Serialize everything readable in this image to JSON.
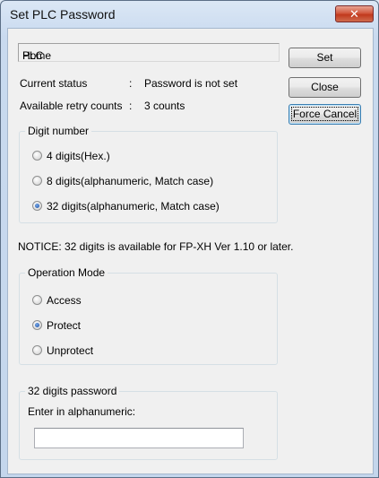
{
  "window": {
    "title": "Set PLC Password",
    "close_glyph": "✕"
  },
  "plc": {
    "label": "PLC",
    "separator": ":",
    "value": "Home"
  },
  "status": {
    "current_label": "Current status",
    "current_sep": ":",
    "current_value": "Password is not set",
    "retry_label": "Available retry counts",
    "retry_sep": ":",
    "retry_value": "3 counts"
  },
  "buttons": {
    "set": "Set",
    "close": "Close",
    "force_cancel": "Force Cancel"
  },
  "digit_group": {
    "title": "Digit number",
    "options": [
      {
        "label": "4 digits(Hex.)",
        "checked": false
      },
      {
        "label": "8 digits(alphanumeric, Match case)",
        "checked": false
      },
      {
        "label": "32 digits(alphanumeric, Match case)",
        "checked": true
      }
    ]
  },
  "notice": "NOTICE: 32 digits is available for FP-XH Ver 1.10 or later.",
  "mode_group": {
    "title": "Operation Mode",
    "options": [
      {
        "label": "Access",
        "checked": false
      },
      {
        "label": "Protect",
        "checked": true
      },
      {
        "label": "Unprotect",
        "checked": false
      }
    ]
  },
  "password_group": {
    "title": "32 digits password",
    "prompt": "Enter in alphanumeric:",
    "value": ""
  },
  "colors": {
    "accent": "#1b4fa5",
    "close_button": "#c1391d"
  }
}
